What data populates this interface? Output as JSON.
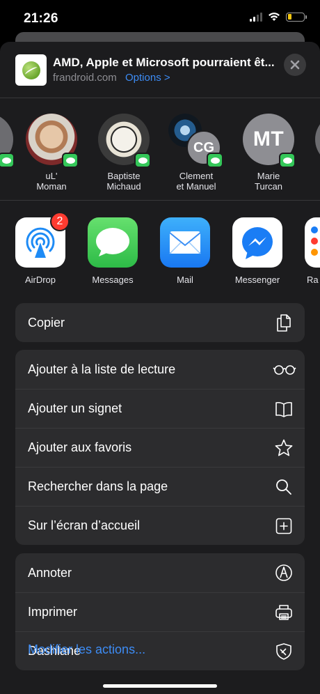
{
  "status_bar": {
    "time": "21:26"
  },
  "share_header": {
    "title": "AMD, Apple et Microsoft pourraient êt...",
    "domain": "frandroid.com",
    "options_label": "Options >"
  },
  "people": [
    {
      "name": "uL'\nMoman"
    },
    {
      "name": "Baptiste\nMichaud"
    },
    {
      "name": "Clement\net Manuel",
      "initials": "CG"
    },
    {
      "name": "Marie\nTurcan",
      "initials": "MT"
    }
  ],
  "apps": [
    {
      "label": "AirDrop",
      "badge": "2"
    },
    {
      "label": "Messages"
    },
    {
      "label": "Mail"
    },
    {
      "label": "Messenger"
    },
    {
      "label": "Ra"
    }
  ],
  "actions": {
    "copy": "Copier",
    "reading_list": "Ajouter à la liste de lecture",
    "bookmark": "Ajouter un signet",
    "favorites": "Ajouter aux favoris",
    "find_in_page": "Rechercher dans la page",
    "home_screen": "Sur l’écran d’accueil",
    "markup": "Annoter",
    "print": "Imprimer",
    "dashlane": "Dashlane"
  },
  "footer": {
    "edit_actions": "Modifier les actions..."
  },
  "colors": {
    "accent": "#3d8cf5",
    "sheet_bg": "#1c1c1e",
    "row_bg": "#2c2c2e"
  }
}
